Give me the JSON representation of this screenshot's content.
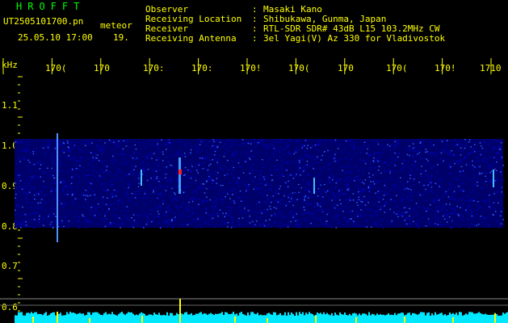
{
  "header": {
    "app_name": "HROFFT",
    "filename": "UT2505101700.pn",
    "type_label": "meteor",
    "datetime": "25.05.10 17:00",
    "count": "19.",
    "fields": [
      {
        "label": "Observer",
        "value": "Masaki Kano"
      },
      {
        "label": "Receiving Location",
        "value": "Shibukawa, Gunma, Japan"
      },
      {
        "label": "Receiver",
        "value": "RTL-SDR SDR# 43dB L15 103.2MHz CW"
      },
      {
        "label": "Receiving Antenna",
        "value": "3el Yagi(V) Az 330 for Vladivostok"
      }
    ]
  },
  "axis": {
    "unit": "kHz",
    "time_ticks": [
      "170(",
      "170",
      "170:",
      "170:",
      "170!",
      "170(",
      "170",
      "170(",
      "170!",
      "1710"
    ],
    "freq_ticks": [
      "1.1",
      "1.0",
      "0.9",
      "0.8",
      "0.7",
      "0.6"
    ]
  },
  "colors": {
    "background": "#000000",
    "text": "#ffff00",
    "title": "#00ff00",
    "noise_low": "#0000c8",
    "noise_high": "#3060ff",
    "signal": "#ff2020",
    "level_trace": "#00e8ff",
    "level_spike": "#ffff00"
  }
}
